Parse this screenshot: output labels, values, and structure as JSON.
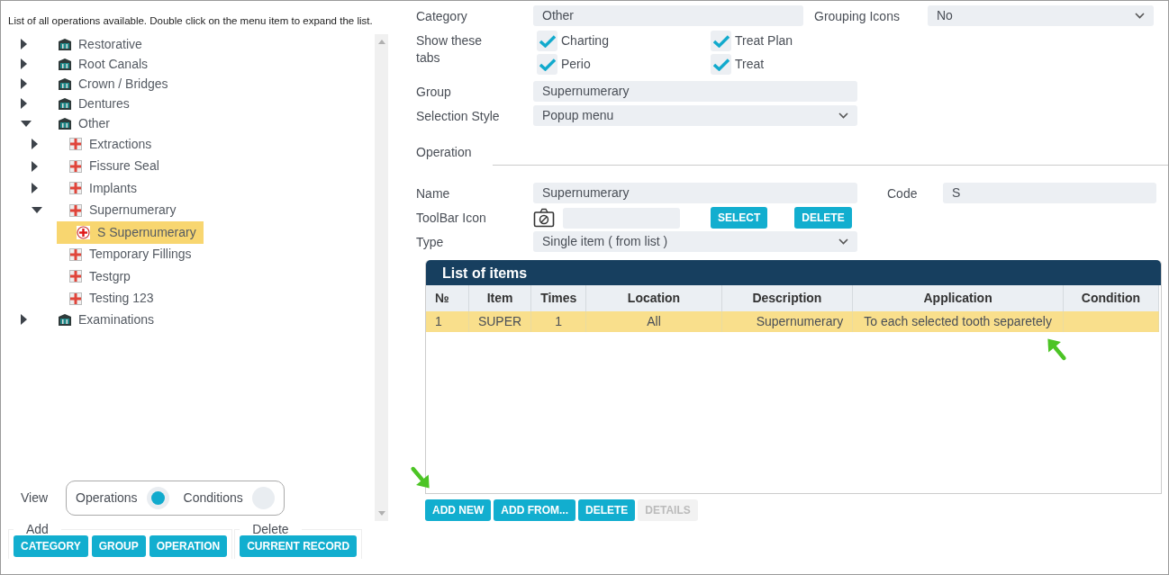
{
  "tree": {
    "instruction": "List of all operations available. Double click on the menu item to expand the list.",
    "items": [
      {
        "label": "Restorative",
        "kind": "category",
        "expanded": false,
        "selected": false
      },
      {
        "label": "Root Canals",
        "kind": "category",
        "expanded": false,
        "selected": false
      },
      {
        "label": "Crown / Bridges",
        "kind": "category",
        "expanded": false,
        "selected": false
      },
      {
        "label": "Dentures",
        "kind": "category",
        "expanded": false,
        "selected": false
      },
      {
        "label": "Other",
        "kind": "category",
        "expanded": true,
        "selected": false,
        "children": [
          {
            "label": "Extractions",
            "kind": "group",
            "expanded": false,
            "selected": false
          },
          {
            "label": "Fissure Seal",
            "kind": "group",
            "expanded": false,
            "selected": false
          },
          {
            "label": "Implants",
            "kind": "group",
            "expanded": false,
            "selected": false
          },
          {
            "label": "Supernumerary",
            "kind": "group",
            "expanded": true,
            "selected": false,
            "children": [
              {
                "label": "S Supernumerary",
                "kind": "operation",
                "selected": true
              }
            ]
          },
          {
            "label": "Temporary Fillings",
            "kind": "group",
            "selected": false
          },
          {
            "label": "Testgrp",
            "kind": "group",
            "selected": false
          },
          {
            "label": "Testing 123",
            "kind": "group",
            "selected": false
          }
        ]
      },
      {
        "label": "Examinations",
        "kind": "category",
        "expanded": false,
        "selected": false
      }
    ]
  },
  "view": {
    "label": "View",
    "options": [
      {
        "label": "Operations",
        "selected": true
      },
      {
        "label": "Conditions",
        "selected": false
      }
    ]
  },
  "add_group": {
    "legend": "Add",
    "buttons": [
      "CATEGORY",
      "GROUP",
      "OPERATION"
    ]
  },
  "delete_group": {
    "legend": "Delete",
    "buttons": [
      "CURRENT RECORD"
    ]
  },
  "form": {
    "category": {
      "label": "Category",
      "value": "Other"
    },
    "grouping_icons": {
      "label": "Grouping Icons",
      "value": "No"
    },
    "show_tabs": {
      "label": "Show these tabs",
      "options": [
        {
          "label": "Charting",
          "checked": true
        },
        {
          "label": "Treat Plan",
          "checked": true
        },
        {
          "label": "Perio",
          "checked": true
        },
        {
          "label": "Treat",
          "checked": true
        }
      ]
    },
    "group": {
      "label": "Group",
      "value": "Supernumerary"
    },
    "selection_style": {
      "label": "Selection Style",
      "value": "Popup menu"
    },
    "operation_heading": "Operation",
    "name": {
      "label": "Name",
      "value": "Supernumerary"
    },
    "code": {
      "label": "Code",
      "value": "S"
    },
    "toolbar_icon": {
      "label": "ToolBar Icon",
      "buttons": [
        "SELECT",
        "DELETE"
      ]
    },
    "type": {
      "label": "Type",
      "value": "Single item ( from list )"
    }
  },
  "list": {
    "title": "List of items",
    "columns": [
      "№",
      "Item",
      "Times",
      "Location",
      "Description",
      "Application",
      "Condition"
    ],
    "rows": [
      {
        "cells": [
          "1",
          "SUPER",
          "1",
          "All",
          "Supernumerary",
          "To each selected tooth separetely",
          ""
        ],
        "selected": true
      }
    ],
    "buttons": [
      {
        "label": "ADD NEW",
        "disabled": false
      },
      {
        "label": "ADD FROM...",
        "disabled": false
      },
      {
        "label": "DELETE",
        "disabled": false
      },
      {
        "label": "DETAILS",
        "disabled": true
      }
    ]
  }
}
